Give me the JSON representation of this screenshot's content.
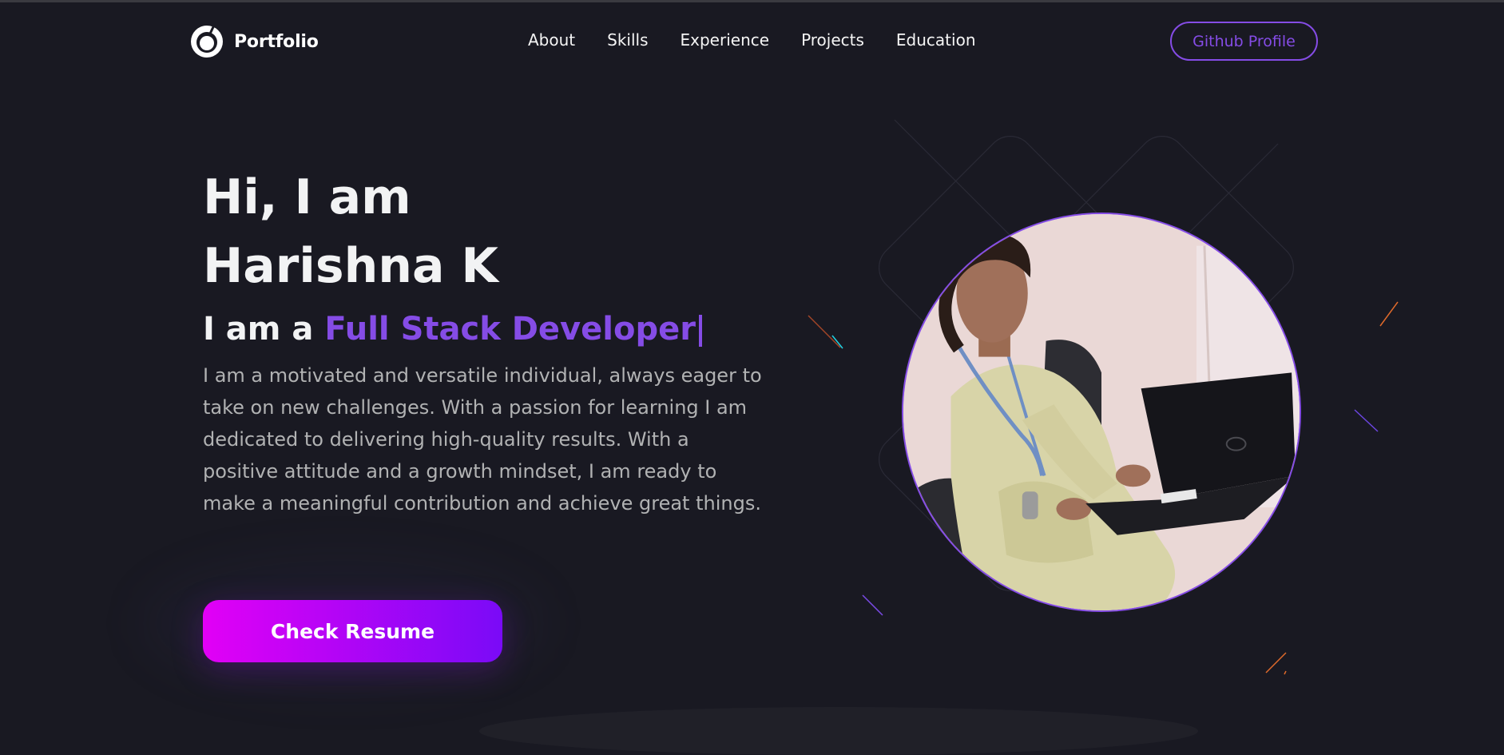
{
  "nav": {
    "brand": "Portfolio",
    "items": [
      "About",
      "Skills",
      "Experience",
      "Projects",
      "Education"
    ],
    "github_label": "Github Profile"
  },
  "hero": {
    "title_line1": "Hi, I am",
    "title_line2": "Harishna K",
    "subtitle_prefix": "I am a",
    "subtitle_role": "Full Stack Developer",
    "description": "I am a motivated and versatile individual, always eager to take on new challenges. With a passion for learning I am dedicated to delivering high-quality results. With a positive attitude and a growth mindset, I am ready to make a meaningful contribution and achieve great things.",
    "resume_label": "Check Resume"
  },
  "colors": {
    "background": "#191922",
    "accent": "#854ce6",
    "text_primary": "#f2f3f4",
    "text_secondary": "#b1b2b3",
    "button_gradient_start": "#e200f6",
    "button_gradient_end": "#7a0af7"
  },
  "icons": {
    "brand": "portfolio-logo-icon"
  }
}
